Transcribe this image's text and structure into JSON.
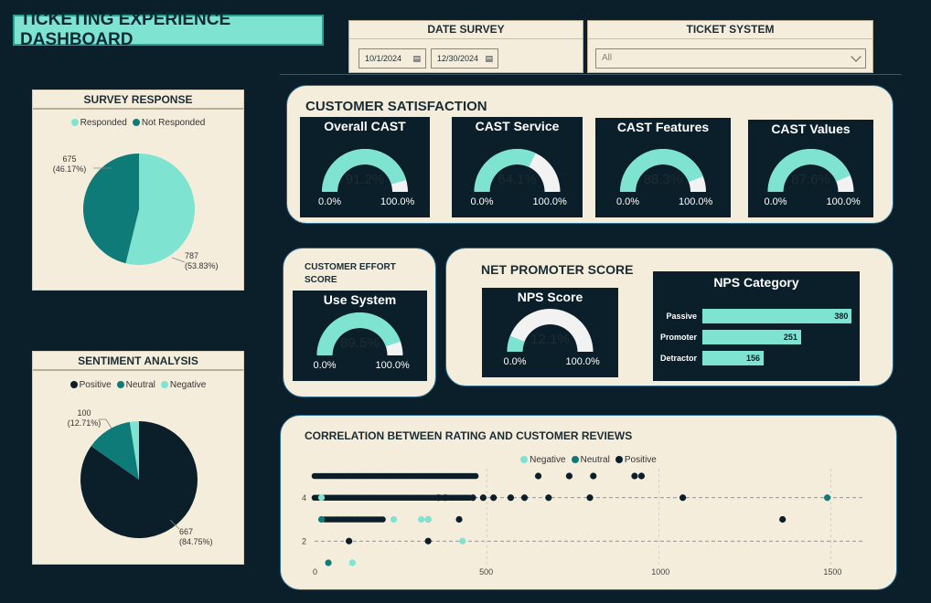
{
  "title": "TICKETING EXPERIENCE DASHBOARD",
  "date_filter": {
    "label": "DATE SURVEY",
    "start": "10/1/2024",
    "end": "12/30/2024"
  },
  "ticket_filter": {
    "label": "TICKET SYSTEM",
    "value": "All"
  },
  "colors": {
    "background": "#0b1f2b",
    "panel": "#f5eddc",
    "accent": "#7fe3d1",
    "dark_teal": "#0e7b78",
    "gauge_empty": "#f2f2f2"
  },
  "survey_response": {
    "title": "SURVEY RESPONSE",
    "legend": [
      {
        "label": "Responded",
        "color": "#7fe3d1"
      },
      {
        "label": "Not Responded",
        "color": "#0e7b78"
      }
    ],
    "slices": [
      {
        "name": "Responded",
        "value": 787,
        "pct_label": "(53.83%)",
        "color": "#7fe3d1"
      },
      {
        "name": "Not Responded",
        "value": 675,
        "pct_label": "(46.17%)",
        "color": "#0e7b78"
      }
    ],
    "labels": {
      "not_value": "675",
      "not_pct": "(46.17%)",
      "resp_value": "787",
      "resp_pct": "(53.83%)"
    }
  },
  "sentiment": {
    "title": "SENTIMENT ANALYSIS",
    "legend": [
      {
        "label": "Positive",
        "color": "#0b1f2b"
      },
      {
        "label": "Neutral",
        "color": "#0e7b78"
      },
      {
        "label": "Negative",
        "color": "#7fe3d1"
      }
    ],
    "slices": [
      {
        "name": "Positive",
        "value": 667,
        "color": "#0b1f2b"
      },
      {
        "name": "Neutral",
        "value": 100,
        "color": "#0e7b78"
      },
      {
        "name": "Negative",
        "value": 20,
        "color": "#7fe3d1"
      }
    ],
    "labels": {
      "neu_value": "100",
      "neu_pct": "(12.71%)",
      "pos_value": "667",
      "pos_pct": "(84.75%)"
    }
  },
  "csat": {
    "title": "CUSTOMER SATISFACTION",
    "gauges": [
      {
        "title": "Overall CAST",
        "value": 91.2,
        "display": "91.2%",
        "min": "0.0%",
        "max": "100.0%"
      },
      {
        "title": "CAST Service",
        "value": 64.1,
        "display": "64.1%",
        "min": "0.0%",
        "max": "100.0%"
      },
      {
        "title": "CAST Features",
        "value": 88.3,
        "display": "88.3%",
        "min": "0.0%",
        "max": "100.0%"
      },
      {
        "title": "CAST Values",
        "value": 87.6,
        "display": "87.6%",
        "min": "0.0%",
        "max": "100.0%"
      }
    ]
  },
  "ces": {
    "title": "CUSTOMER EFFORT SCORE",
    "gauge": {
      "title": "Use System",
      "value": 89.5,
      "display": "89.5%",
      "min": "0.0%",
      "max": "100.0%"
    }
  },
  "nps": {
    "title": "NET PROMOTER SCORE",
    "gauge": {
      "title": "NPS Score",
      "value": 12.1,
      "display": "12.1%",
      "min": "0.0%",
      "max": "100.0%"
    },
    "category_title": "NPS Category",
    "categories": [
      {
        "label": "Passive",
        "value": 380,
        "display": "380"
      },
      {
        "label": "Promoter",
        "value": 251,
        "display": "251"
      },
      {
        "label": "Detractor",
        "value": 156,
        "display": "156"
      }
    ]
  },
  "correlation": {
    "title": "CORRELATION BETWEEN RATING AND CUSTOMER REVIEWS",
    "legend": [
      {
        "label": "Negative",
        "color": "#7fe3d1"
      },
      {
        "label": "Neutral",
        "color": "#0e7b78"
      },
      {
        "label": "Positive",
        "color": "#0b1f2b"
      }
    ],
    "x_ticks": [
      "0",
      "500",
      "1000",
      "1500"
    ],
    "y_ticks": [
      "4",
      "2"
    ],
    "chart_data": {
      "type": "scatter",
      "xlim": [
        0,
        1600
      ],
      "ylim": [
        1,
        5
      ],
      "series": [
        {
          "name": "Positive",
          "color": "#0b1f2b",
          "points": [
            [
              650,
              5
            ],
            [
              740,
              5
            ],
            [
              810,
              5
            ],
            [
              930,
              5
            ],
            [
              950,
              5
            ],
            [
              460,
              4
            ],
            [
              490,
              4
            ],
            [
              520,
              4
            ],
            [
              570,
              4
            ],
            [
              610,
              4
            ],
            [
              680,
              4
            ],
            [
              800,
              4
            ],
            [
              1070,
              4
            ],
            [
              1360,
              3
            ],
            [
              420,
              3
            ],
            [
              330,
              2
            ],
            [
              100,
              2
            ],
            [
              360,
              4
            ],
            [
              380,
              4
            ]
          ]
        },
        {
          "name": "Neutral",
          "color": "#0e7b78",
          "points": [
            [
              1490,
              4
            ],
            [
              40,
              1
            ],
            [
              20,
              3
            ],
            [
              330,
              3
            ]
          ]
        },
        {
          "name": "Negative",
          "color": "#7fe3d1",
          "points": [
            [
              110,
              1
            ],
            [
              430,
              2
            ],
            [
              230,
              3
            ],
            [
              310,
              3
            ],
            [
              330,
              3
            ],
            [
              20,
              4
            ]
          ]
        }
      ],
      "dense_rows": [
        {
          "y": 5,
          "x_from": 0,
          "x_to": 470,
          "series": "Positive"
        },
        {
          "y": 4,
          "x_from": 0,
          "x_to": 450,
          "series": "Positive"
        },
        {
          "y": 3,
          "x_from": 30,
          "x_to": 200,
          "series": "Positive"
        }
      ]
    }
  }
}
